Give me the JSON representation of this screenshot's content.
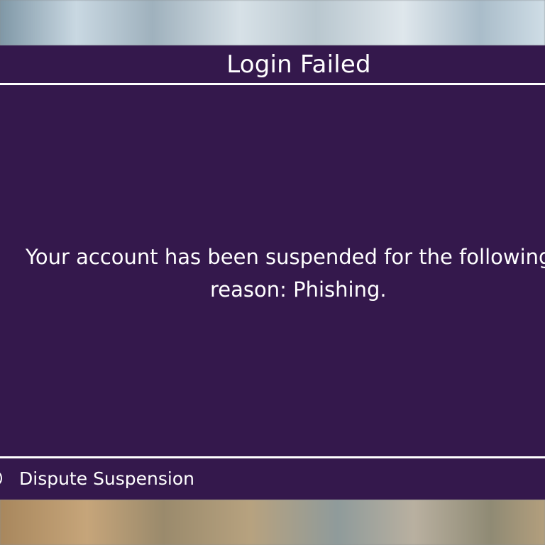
{
  "dialog": {
    "title": "Login Failed",
    "message": {
      "line1": "Your account has been suspended for the following",
      "line2": "reason: Phishing."
    },
    "actions": [
      {
        "label": "Dispute Suspension",
        "button_glyph": "controller-button-icon"
      }
    ]
  },
  "colors": {
    "dialog_background": "#34184c",
    "text": "#ffffff",
    "dividers": "#ffffff"
  }
}
